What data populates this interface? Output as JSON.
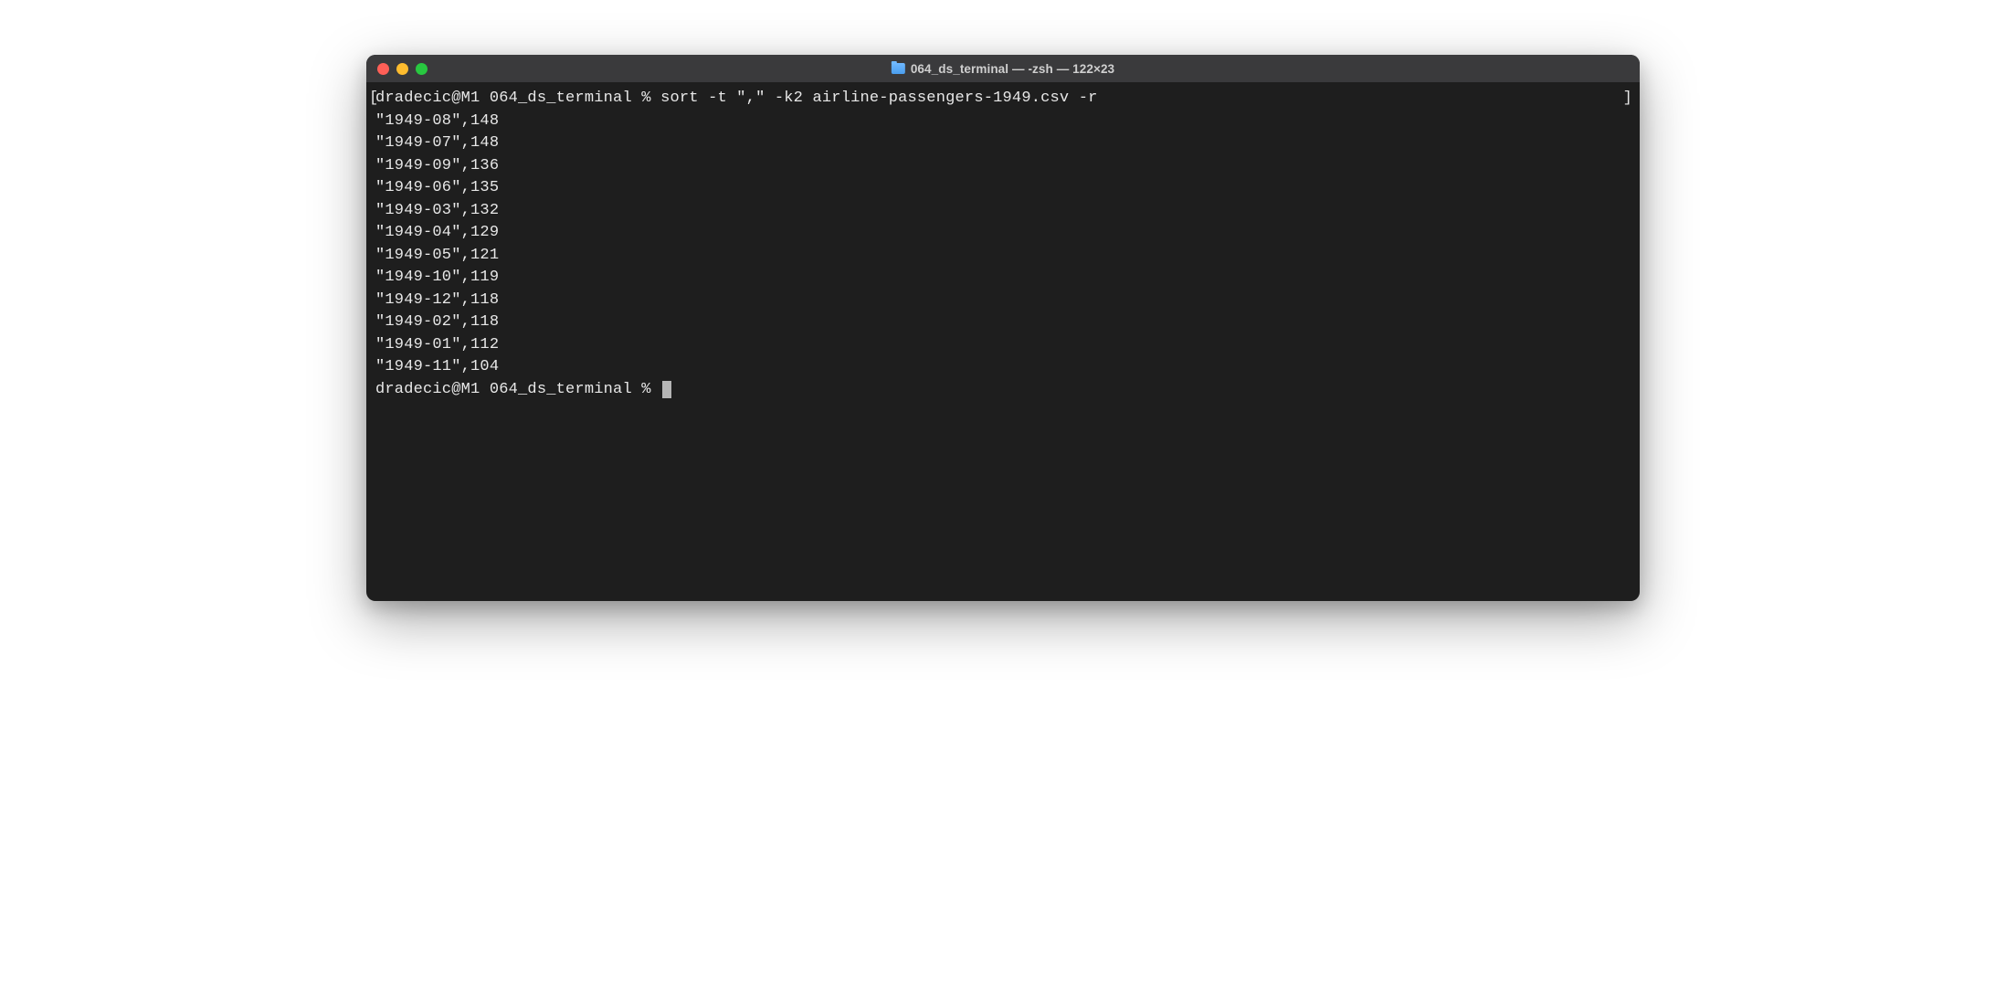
{
  "window": {
    "title": "064_ds_terminal — -zsh — 122×23"
  },
  "terminal": {
    "left_bracket": "[",
    "right_bracket": "]",
    "prompt1": "dradecic@M1 064_ds_terminal % ",
    "command1": "sort -t \",\" -k2 airline-passengers-1949.csv -r",
    "output": [
      "\"1949-08\",148",
      "\"1949-07\",148",
      "\"1949-09\",136",
      "\"1949-06\",135",
      "\"1949-03\",132",
      "\"1949-04\",129",
      "\"1949-05\",121",
      "\"1949-10\",119",
      "\"1949-12\",118",
      "\"1949-02\",118",
      "\"1949-01\",112",
      "\"1949-11\",104"
    ],
    "prompt2": "dradecic@M1 064_ds_terminal % "
  }
}
